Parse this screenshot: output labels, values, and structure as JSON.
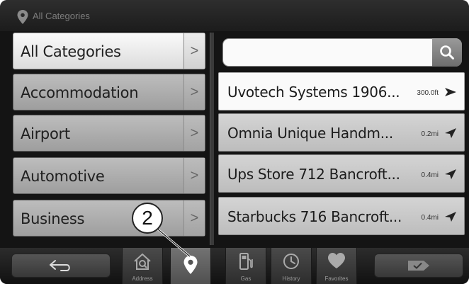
{
  "header": {
    "title": "All Categories",
    "icon": "map-pin-icon"
  },
  "categories": [
    {
      "label": "All Categories",
      "active": true
    },
    {
      "label": "Accommodation"
    },
    {
      "label": "Airport"
    },
    {
      "label": "Automotive"
    },
    {
      "label": "Business"
    }
  ],
  "category_arrow": ">",
  "search": {
    "placeholder": "",
    "value": "",
    "icon": "search-icon"
  },
  "results": [
    {
      "name": "Uvotech Systems 1906...",
      "distance": "300.0ft",
      "icon": "arrow-right-icon"
    },
    {
      "name": "Omnia Unique Handm...",
      "distance": "0.2mi",
      "icon": "arrow-northeast-icon"
    },
    {
      "name": "Ups Store 712 Bancroft...",
      "distance": "0.4mi",
      "icon": "arrow-northeast-icon"
    },
    {
      "name": "Starbucks 716 Bancroft...",
      "distance": "0.4mi",
      "icon": "arrow-northeast-icon"
    }
  ],
  "toolbar": {
    "back_icon": "back-arrow-icon",
    "address_label": "Address",
    "poi_icon": "map-pin-icon",
    "gas_label": "Gas",
    "history_label": "History",
    "favorites_label": "Favorites",
    "tag_icon": "tag-icon"
  },
  "callout": {
    "number": "2"
  },
  "colors": {
    "background": "#141414",
    "row_selected": "#fafafa",
    "row": "#c8c8c8"
  }
}
